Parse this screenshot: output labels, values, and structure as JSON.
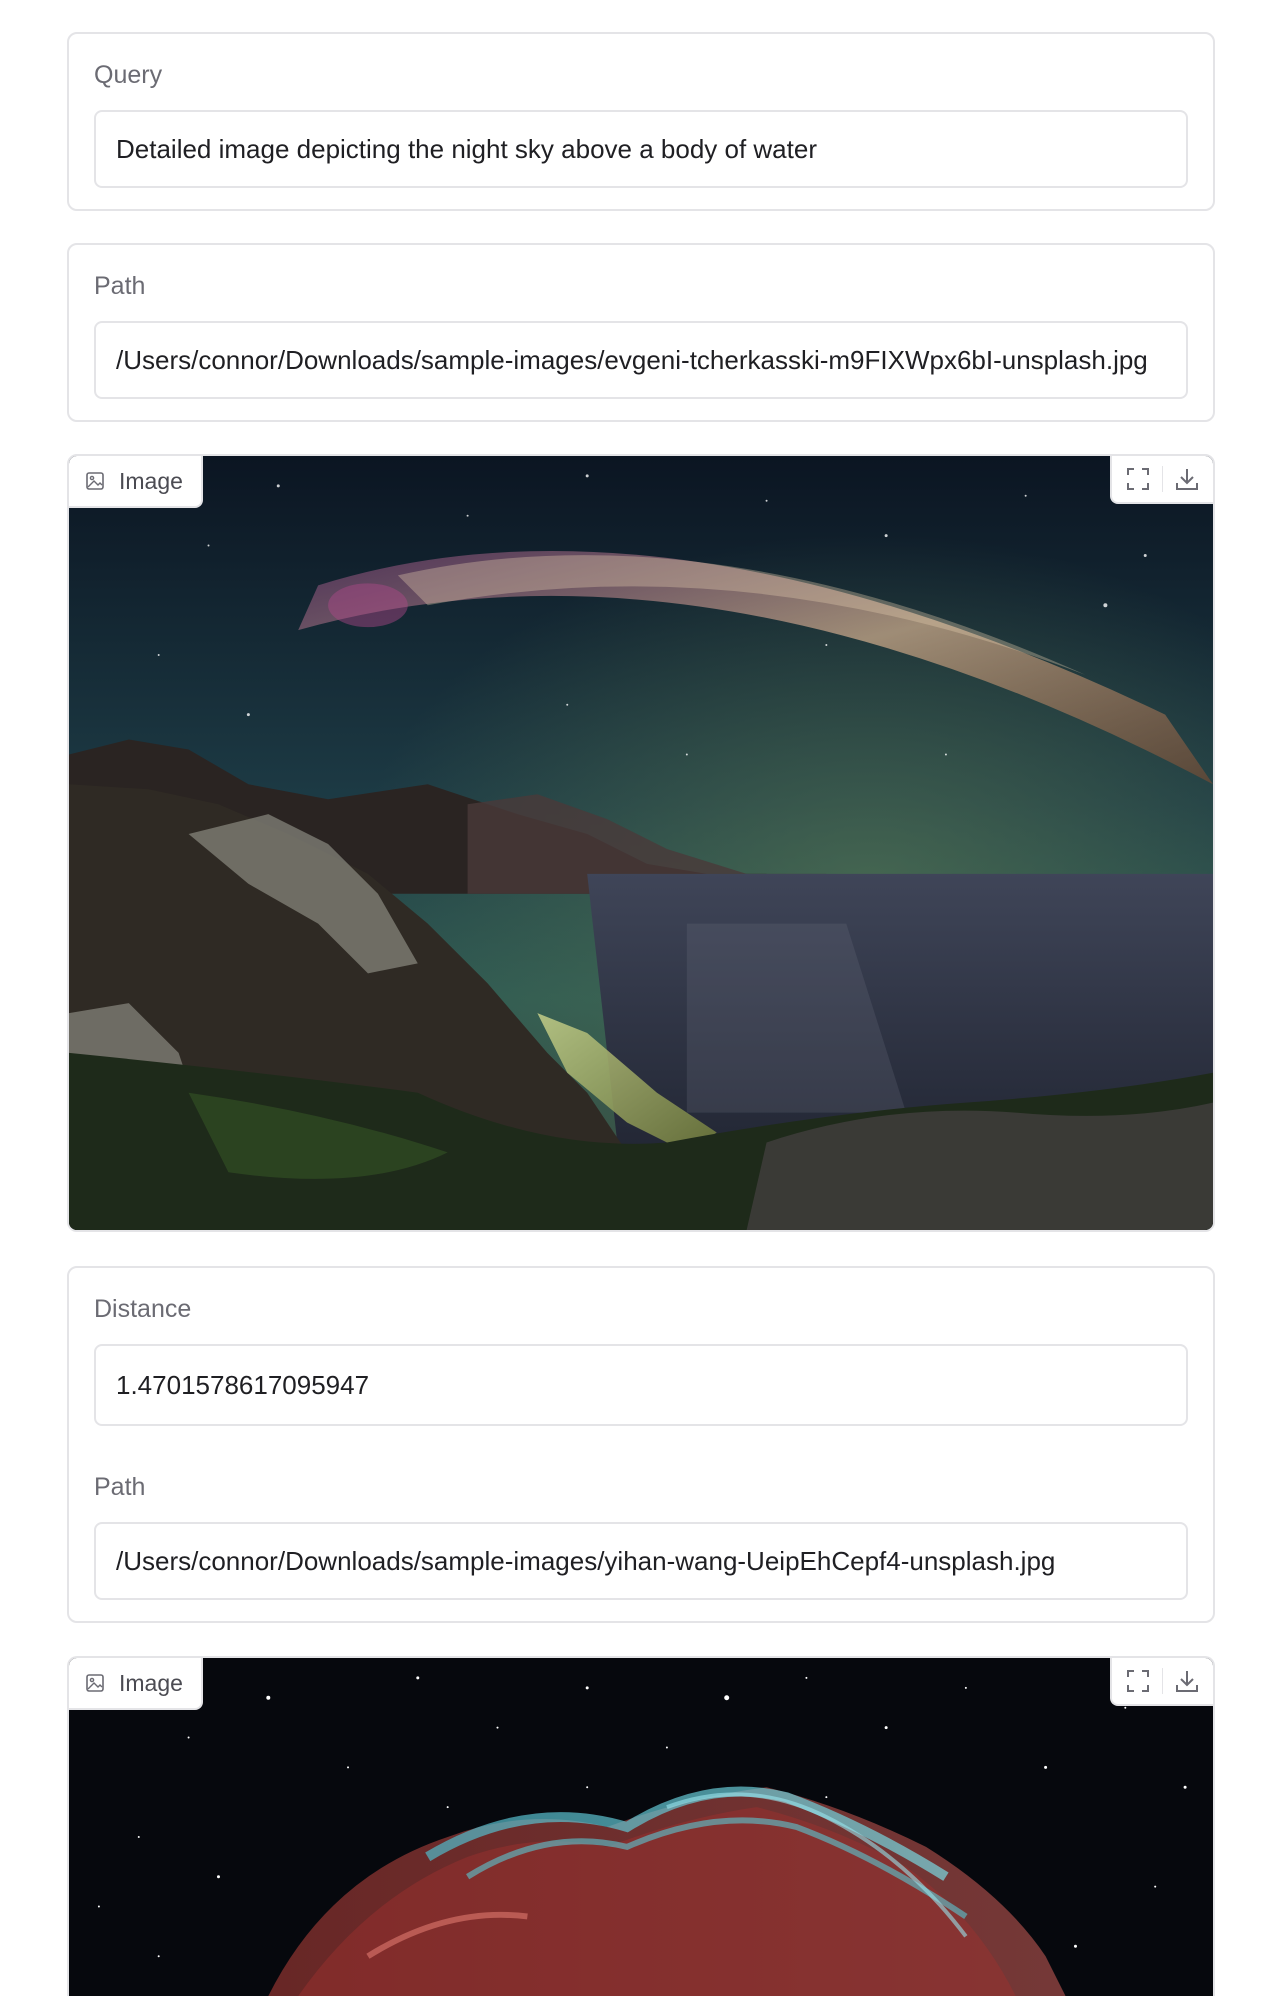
{
  "query": {
    "label": "Query",
    "value": "Detailed image depicting the night sky above a body of water"
  },
  "result_1": {
    "path_label": "Path",
    "path_value": "/Users/connor/Downloads/sample-images/evgeni-tcherkasski-m9FIXWpx6bI-unsplash.jpg",
    "image_label": "Image"
  },
  "result_2": {
    "distance_label": "Distance",
    "distance_value": "1.4701578617095947",
    "path_label": "Path",
    "path_value": "/Users/connor/Downloads/sample-images/yihan-wang-UeipEhCepf4-unsplash.jpg",
    "image_label": "Image"
  },
  "icons": {
    "image": "image-icon",
    "fullscreen": "fullscreen-icon",
    "download": "download-icon"
  }
}
